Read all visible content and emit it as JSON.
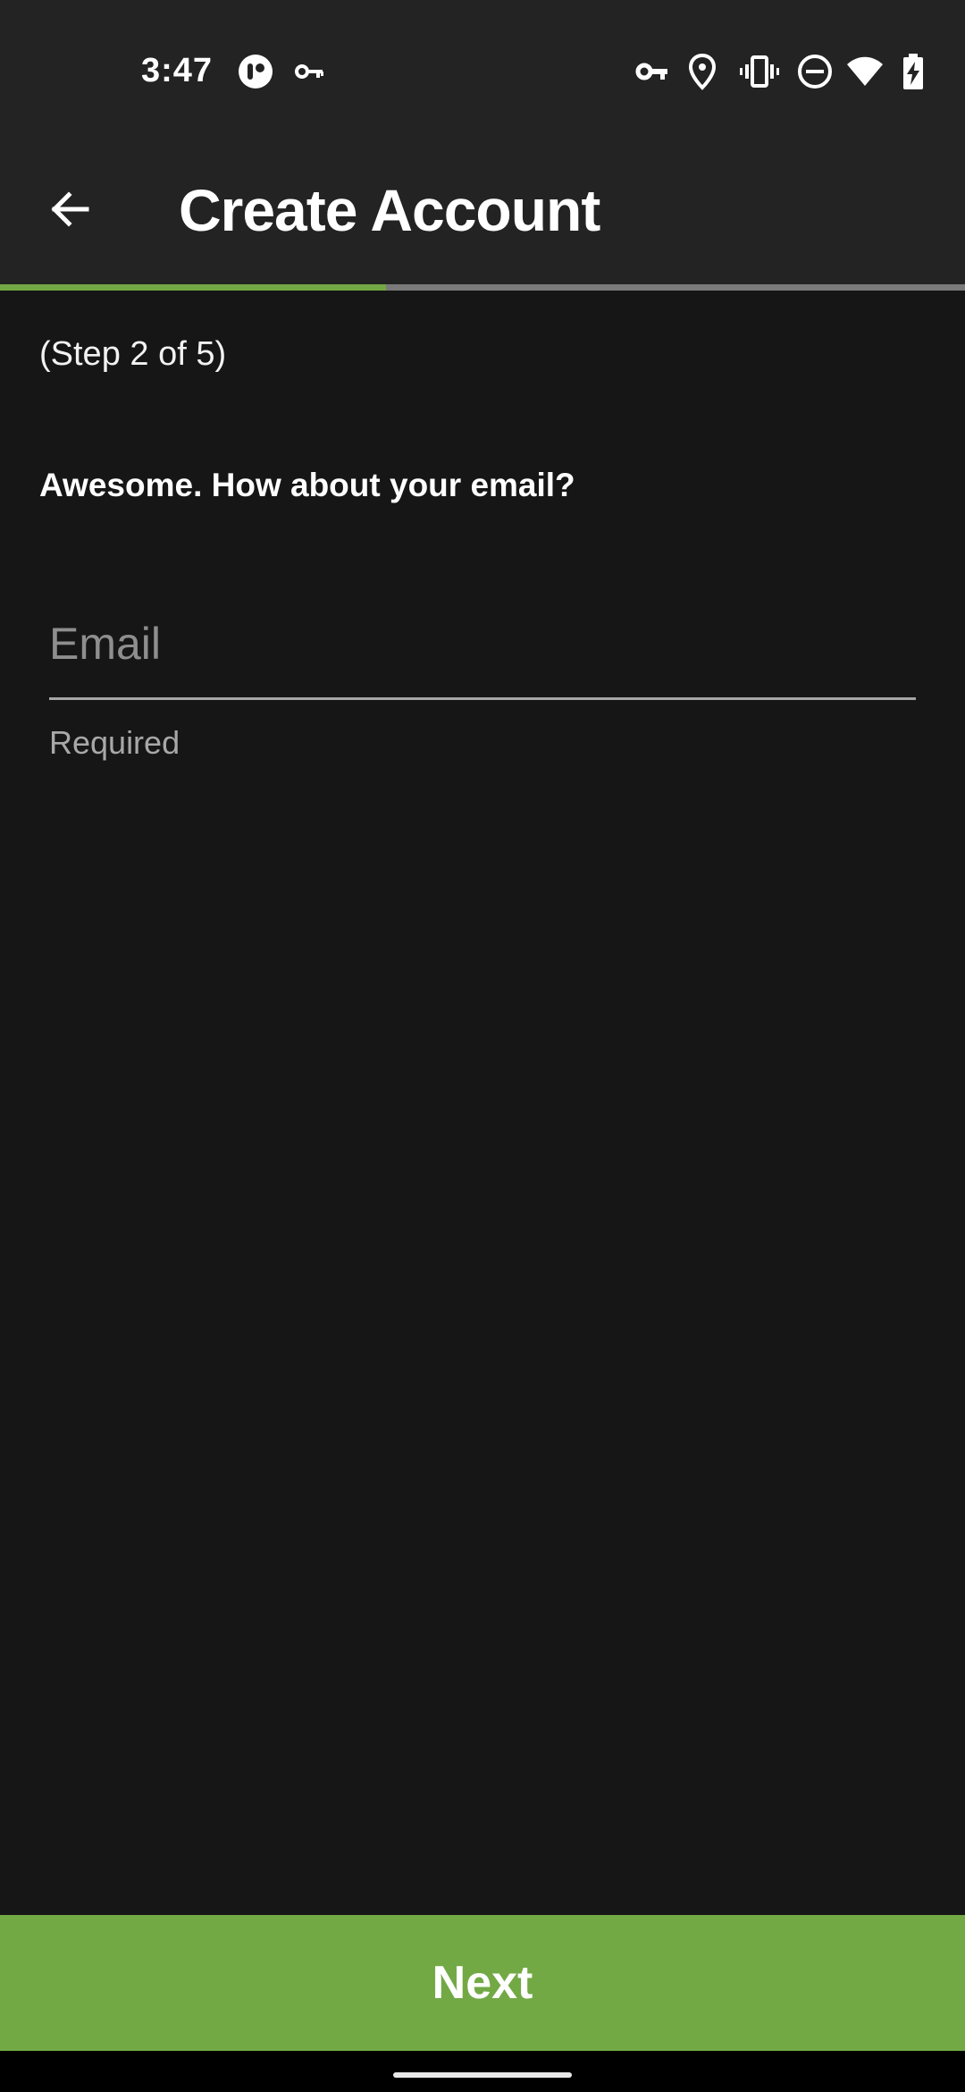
{
  "status_bar": {
    "time": "3:47",
    "icons": [
      "app-notification-icon",
      "vpn-key-icon",
      "vpn-key-icon",
      "location-pin-icon",
      "vibrate-icon",
      "do-not-disturb-icon",
      "wifi-icon",
      "battery-charging-icon"
    ]
  },
  "app_bar": {
    "back_icon": "arrow-left-icon",
    "title": "Create Account"
  },
  "progress": {
    "current_step": 2,
    "total_steps": 5,
    "fraction": 0.4,
    "fill_color": "#72a945",
    "track_color": "#7a7a7a"
  },
  "form": {
    "step_label": "(Step 2 of 5)",
    "prompt": "Awesome. How about your email?",
    "email": {
      "value": "",
      "placeholder": "Email",
      "helper": "Required"
    }
  },
  "footer": {
    "next_label": "Next",
    "button_color": "#72a945"
  },
  "colors": {
    "background": "#161616",
    "bar_background": "#232323",
    "accent": "#72a945"
  }
}
